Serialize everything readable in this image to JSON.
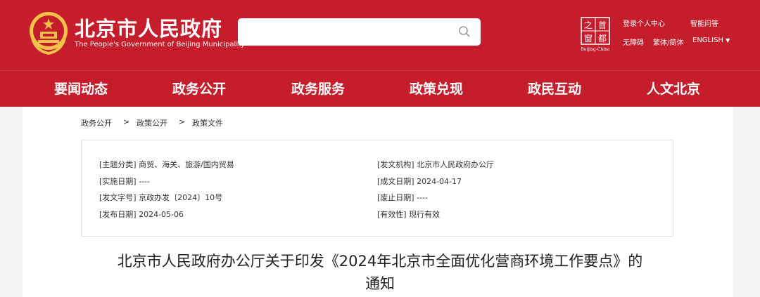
{
  "header": {
    "site_name": "北京市人民政府",
    "site_name_en": "The People's Government of Beijing Municipality",
    "search": {
      "placeholder": ""
    },
    "seal_chars": [
      "首",
      "都",
      "之",
      "窗"
    ],
    "seal_caption": "Beijing-China",
    "links": {
      "personal_center": "登录个人中心",
      "smart_qa": "智能问答",
      "accessibility": "无障碍",
      "traditional_simplified": "繁体/简体",
      "english": "ENGLISH"
    },
    "colors": {
      "brand_red": "#c51d2c",
      "gold": "#f3c24a"
    }
  },
  "nav": {
    "items": [
      "要闻动态",
      "政务公开",
      "政务服务",
      "政策兑现",
      "政民互动",
      "人文北京"
    ]
  },
  "breadcrumb": {
    "items": [
      "政务公开",
      "政策公开",
      "政策文件"
    ],
    "separator": ">"
  },
  "meta": {
    "topic": "[主题分类] 商贸、海关、旅游/国内贸易",
    "issuer": "[发文机构] 北京市人民政府办公厅",
    "effective_date": "[实施日期] ----",
    "created_date": "[成文日期] 2024-04-17",
    "doc_number": "[发文字号] 京政办发〔2024〕10号",
    "abolish_date": "[废止日期] ----",
    "publish_date": "[发布日期] 2024-05-06",
    "validity": "[有效性] 现行有效"
  },
  "document": {
    "title_line1": "北京市人民政府办公厅关于印发《2024年北京市全面优化营商环境工作要点》的",
    "title_line2": "通知"
  }
}
